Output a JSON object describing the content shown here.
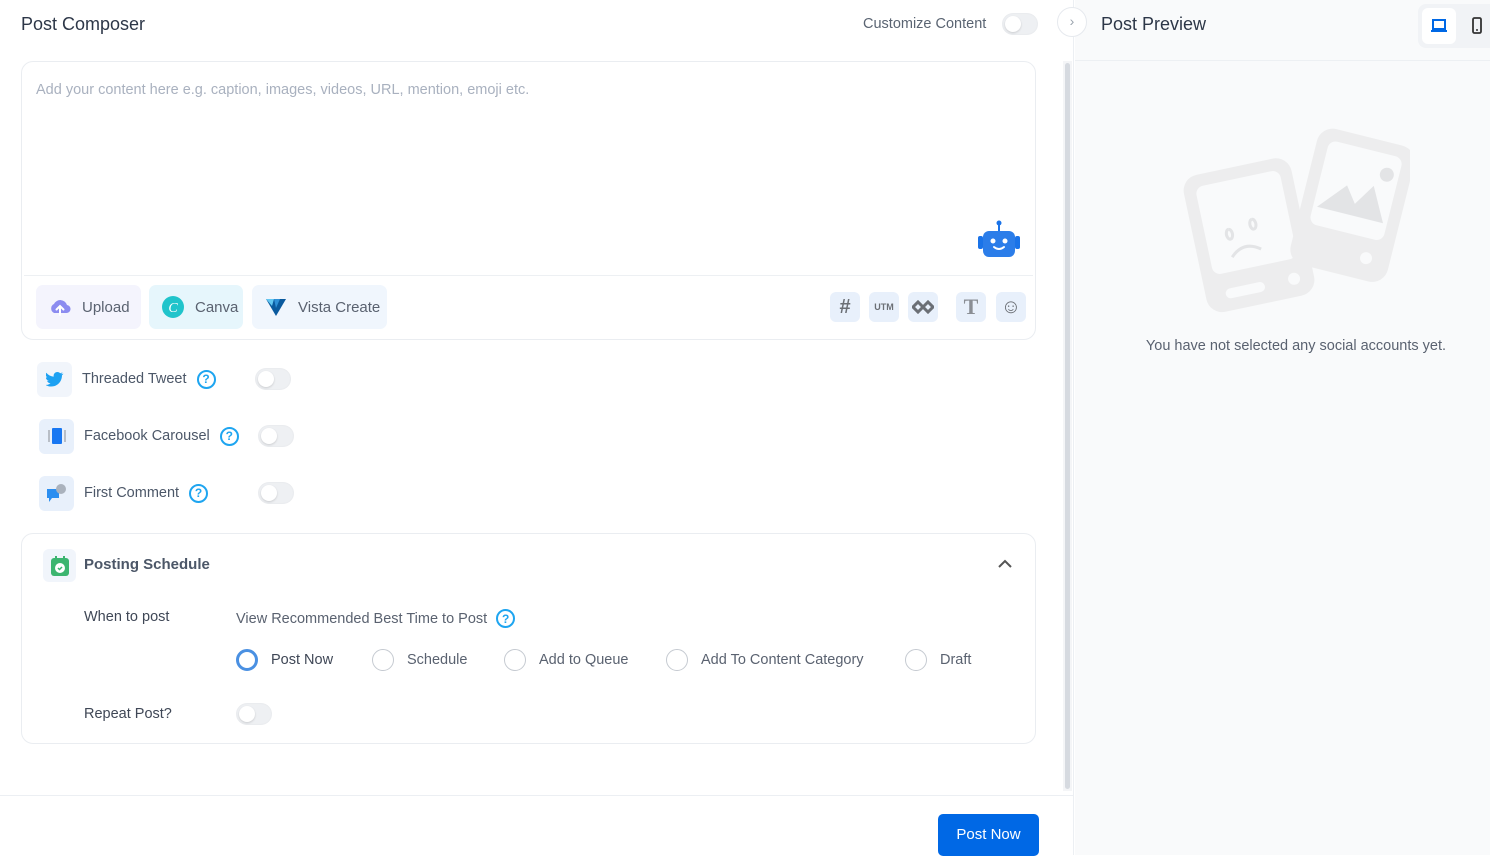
{
  "composer": {
    "title": "Post Composer",
    "customize_label": "Customize Content",
    "customize_enabled": false,
    "editor_placeholder": "Add your content here e.g. caption, images, videos, URL, mention, emoji etc.",
    "media_buttons": [
      {
        "label": "Upload",
        "icon": "upload-cloud-icon"
      },
      {
        "label": "Canva",
        "icon": "canva-icon"
      },
      {
        "label": "Vista Create",
        "icon": "vista-create-icon"
      }
    ],
    "editor_tools": [
      {
        "icon": "hashtag-icon",
        "label": "#"
      },
      {
        "icon": "utm-icon",
        "label": "UTM"
      },
      {
        "icon": "link-shortener-icon",
        "label": ""
      },
      {
        "icon": "text-format-icon",
        "label": "T"
      },
      {
        "icon": "emoji-icon",
        "label": "☺"
      }
    ],
    "features": [
      {
        "label": "Threaded Tweet",
        "icon": "twitter-icon",
        "enabled": false
      },
      {
        "label": "Facebook Carousel",
        "icon": "carousel-icon",
        "enabled": false
      },
      {
        "label": "First Comment",
        "icon": "comment-icon",
        "enabled": false
      }
    ],
    "help_glyph": "?",
    "schedule": {
      "title": "Posting Schedule",
      "when_label": "When to post",
      "recommend_link": "View Recommended Best Time to Post",
      "options": [
        "Post Now",
        "Schedule",
        "Add to Queue",
        "Add To Content Category",
        "Draft"
      ],
      "selected": "Post Now",
      "repeat_label": "Repeat Post?",
      "repeat_enabled": false
    },
    "submit_label": "Post Now"
  },
  "preview": {
    "title": "Post Preview",
    "collapse_glyph": "›",
    "devices": [
      "desktop",
      "mobile"
    ],
    "selected_device": "desktop",
    "empty_message": "You have not selected any social accounts yet."
  },
  "colors": {
    "primary": "#0068e5",
    "help": "#1ea5f0",
    "radio_selected": "#4a90e2"
  }
}
